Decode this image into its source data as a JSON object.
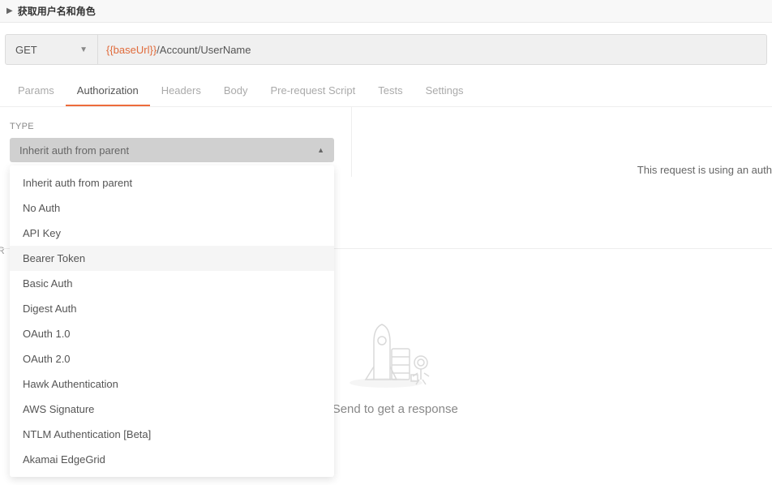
{
  "titleBar": {
    "title": "获取用户名和角色"
  },
  "request": {
    "method": "GET",
    "urlVariable": "{{baseUrl}}",
    "urlPath": "/Account/UserName"
  },
  "tabs": {
    "params": "Params",
    "authorization": "Authorization",
    "headers": "Headers",
    "body": "Body",
    "prerequest": "Pre-request Script",
    "tests": "Tests",
    "settings": "Settings"
  },
  "auth": {
    "typeLabel": "TYPE",
    "selected": "Inherit auth from parent",
    "options": [
      "Inherit auth from parent",
      "No Auth",
      "API Key",
      "Bearer Token",
      "Basic Auth",
      "Digest Auth",
      "OAuth 1.0",
      "OAuth 2.0",
      "Hawk Authentication",
      "AWS Signature",
      "NTLM Authentication [Beta]",
      "Akamai EdgeGrid"
    ],
    "hoveredIndex": 3,
    "rightText": "This request is using an auth",
    "leftR": "R"
  },
  "response": {
    "emptyText": "Hit Send to get a response"
  }
}
